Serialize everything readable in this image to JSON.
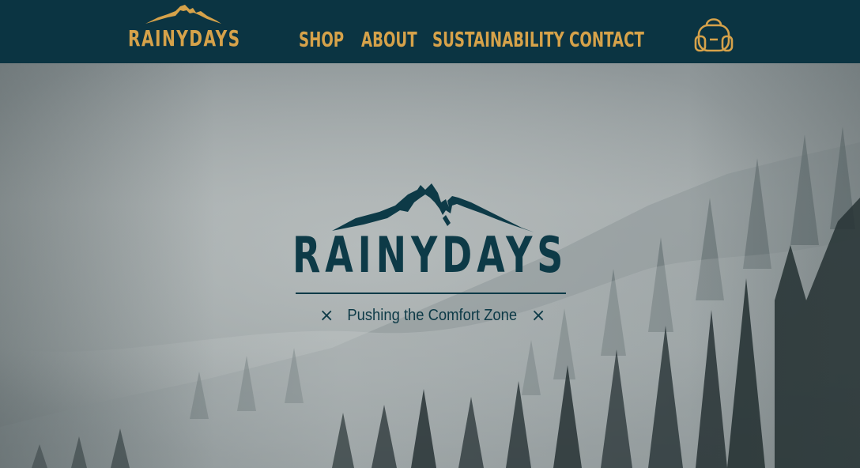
{
  "header": {
    "logo_text": "RAINYDAYS",
    "nav": [
      {
        "label": "SHOP"
      },
      {
        "label": "ABOUT"
      },
      {
        "label": "SUSTAINABILITY"
      },
      {
        "label": "CONTACT"
      }
    ],
    "cart_icon": "backpack-icon"
  },
  "hero": {
    "brand": "RAINYDAYS",
    "tagline": "Pushing the Comfort Zone",
    "tagline_mark_left": "×",
    "tagline_mark_right": "×",
    "background": "foggy-forest-image"
  },
  "colors": {
    "header_bg": "#0b3442",
    "accent_gold": "#d6a24a",
    "brand_dark": "#0d3a47"
  }
}
